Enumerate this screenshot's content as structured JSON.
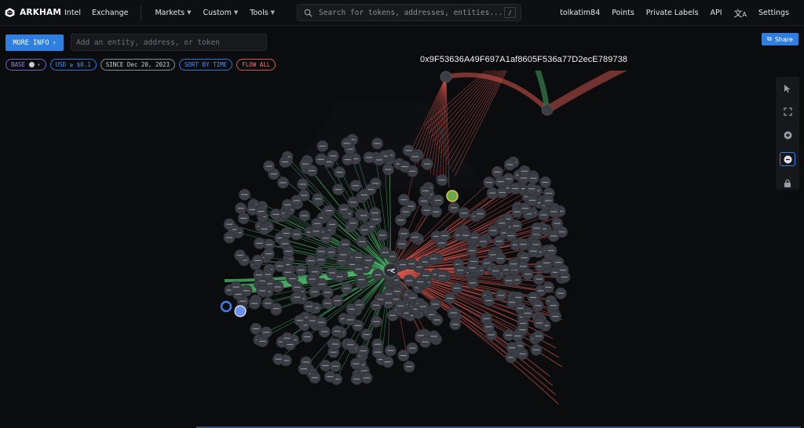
{
  "nav": {
    "logo_text": "ARKHAM",
    "links": [
      "Intel",
      "Exchange"
    ],
    "dropdowns": [
      "Markets",
      "Custom",
      "Tools"
    ],
    "search_placeholder": "Search for tokens, addresses, entities...",
    "search_shortcut": "/",
    "right_links": [
      "tolkatim84",
      "Points",
      "Private Labels",
      "API"
    ],
    "settings_label": "Settings"
  },
  "toolbar": {
    "more_info_label": "MORE INFO",
    "more_info_icon": "chevron-right-icon",
    "entity_placeholder": "Add an entity, address, or token",
    "filters": {
      "base": "BASE",
      "usd": "USD ≥ $0.1",
      "since": "SINCE Dec 20, 2023",
      "sort": "SORT BY TIME",
      "flow": "FLOW ALL"
    },
    "share_label": "Share"
  },
  "graph": {
    "hover_address": "0x9F53636A49F697A1af8605F536a77D2ecE789738",
    "colors": {
      "inflow": "#4caf68",
      "outflow": "#d9574f",
      "node": "#3b3e44",
      "background": "#0b0c0e"
    }
  },
  "side_tools": [
    "pointer-icon",
    "fit-screen-icon",
    "zoom-in-icon",
    "zoom-out-icon",
    "lock-icon"
  ]
}
